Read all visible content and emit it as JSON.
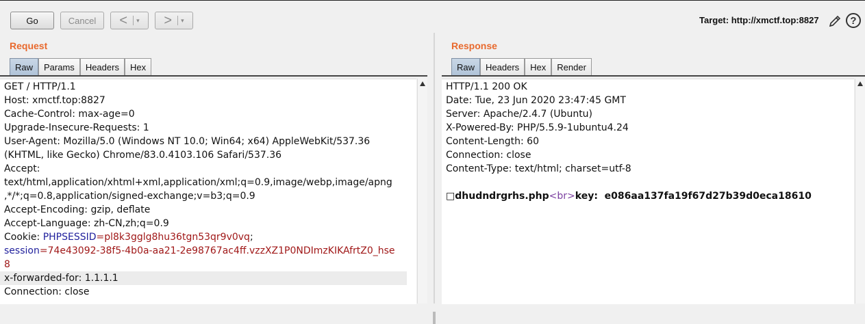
{
  "toolbar": {
    "go_label": "Go",
    "cancel_label": "Cancel",
    "back_label": "<",
    "forward_label": ">",
    "dropdown_glyph": "▾",
    "target_label": "Target: http://xmctf.top:8827",
    "edit_icon": "pencil-icon",
    "help_icon": "help-icon",
    "help_glyph": "?"
  },
  "request": {
    "title": "Request",
    "tabs": [
      "Raw",
      "Params",
      "Headers",
      "Hex"
    ],
    "active_tab": "Raw",
    "lines": [
      "GET / HTTP/1.1",
      "Host: xmctf.top:8827",
      "Cache-Control: max-age=0",
      "Upgrade-Insecure-Requests: 1",
      "User-Agent: Mozilla/5.0 (Windows NT 10.0; Win64; x64) AppleWebKit/537.36",
      "(KHTML, like Gecko) Chrome/83.0.4103.106 Safari/537.36",
      "Accept:",
      "text/html,application/xhtml+xml,application/xml;q=0.9,image/webp,image/apng",
      ",*/*;q=0.8,application/signed-exchange;v=b3;q=0.9",
      "Accept-Encoding: gzip, deflate",
      "Accept-Language: zh-CN,zh;q=0.9",
      "x-forwarded-for: 1.1.1.1",
      "Connection: close"
    ],
    "cookie_prefix": "Cookie: ",
    "cookie_1_key": "PHPSESSID",
    "cookie_1_val": "=pl8k3gglg8hu36tgn53qr9v0vq",
    "cookie_1_sep": ";",
    "cookie_2_key": "session",
    "cookie_2_val_a": "=74e43092-38f5-4b0a-aa21-2e98767ac4ff.vzzXZ1P0NDImzKIKAfrtZ0_hse",
    "cookie_2_val_b": "8"
  },
  "response": {
    "title": "Response",
    "tabs": [
      "Raw",
      "Headers",
      "Hex",
      "Render"
    ],
    "active_tab": "Raw",
    "lines": [
      "HTTP/1.1 200 OK",
      "Date: Tue, 23 Jun 2020 23:47:45 GMT",
      "Server: Apache/2.4.7 (Ubuntu)",
      "X-Powered-By: PHP/5.5.9-1ubuntu4.24",
      "Content-Length: 60",
      "Connection: close",
      "Content-Type: text/html; charset=utf-8",
      ""
    ],
    "body_file": "dhudndrgrhs.php",
    "body_tag": "<br>",
    "body_key": "key:  e086aa137fa19f67d27b39d0eca18610",
    "body_box_glyph": "□"
  },
  "colors": {
    "title_orange": "#e8692d",
    "cookie_key": "#1f1f9c",
    "cookie_value": "#a01818",
    "html_tag": "#7b3fa0",
    "active_tab": "#b0c3d8"
  }
}
